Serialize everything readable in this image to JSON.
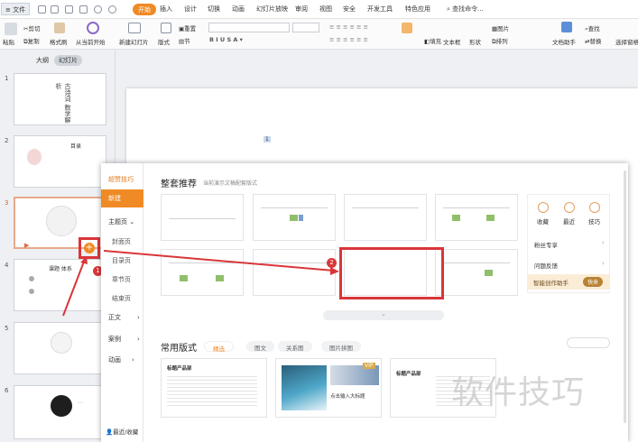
{
  "menubar": {
    "file": "文件",
    "tabs": [
      "开始",
      "插入",
      "设计",
      "切换",
      "动画",
      "幻灯片放映",
      "审阅",
      "视图",
      "安全",
      "开发工具",
      "特色应用"
    ],
    "search": "查找命令..."
  },
  "ribbon": {
    "paste": "粘贴",
    "cut": "剪切",
    "copy": "复制",
    "format_painter": "格式刷",
    "play_from_current": "从当前开始",
    "new_slide": "新建幻灯片",
    "layout": "版式",
    "section": "节",
    "reset": "重置",
    "fill": "填充",
    "textbox": "文本框",
    "shape": "形状",
    "arrange": "排列",
    "picture": "图片",
    "doc_assistant": "文档助手",
    "find": "查找",
    "replace": "替换",
    "select_pane": "选择窗格"
  },
  "panel": {
    "tab_outline": "大纲",
    "tab_slides": "幻灯片",
    "slide_numbers": [
      "1",
      "2",
      "3",
      "4",
      "5",
      "6"
    ],
    "slide1_title": "古诗词 数学解析",
    "slide2_title": "目录",
    "slide4_title": "课题 体系",
    "slide6_text": "…"
  },
  "canvas": {
    "page_badge": "1"
  },
  "popup": {
    "sidebar": {
      "tips": "超赞技巧",
      "new": "新建",
      "theme_pages": "主题页",
      "cover": "封面页",
      "toc": "目录页",
      "section_page": "章节页",
      "end_page": "结束页",
      "body": "正文",
      "case": "案例",
      "animation": "动画",
      "recent": "最近/收藏"
    },
    "section_title": "整套推荐",
    "section_sub": "当前演示文稿配套版式",
    "right_panel": {
      "collect": "收藏",
      "recent": "最近",
      "tips": "技巧",
      "fans": "粉丝专享",
      "feedback": "问题反馈",
      "assistant": "智能创作助手",
      "try": "快来"
    },
    "common_title": "常用版式",
    "filters": [
      "精选",
      "图文",
      "关系图",
      "图片拼图"
    ],
    "bottom_cards": {
      "c1_title": "标题产品部",
      "c2_caption": "点击输入大标题",
      "c2_vip": "VIP",
      "c3_title": "标题产品部"
    }
  },
  "annotations": {
    "badge1": "1",
    "badge2": "2",
    "plus": "+"
  },
  "watermark": "软件技巧",
  "colors": {
    "accent": "#f08a24",
    "highlight": "#d9363a",
    "panel_bg": "#eef0f3"
  }
}
